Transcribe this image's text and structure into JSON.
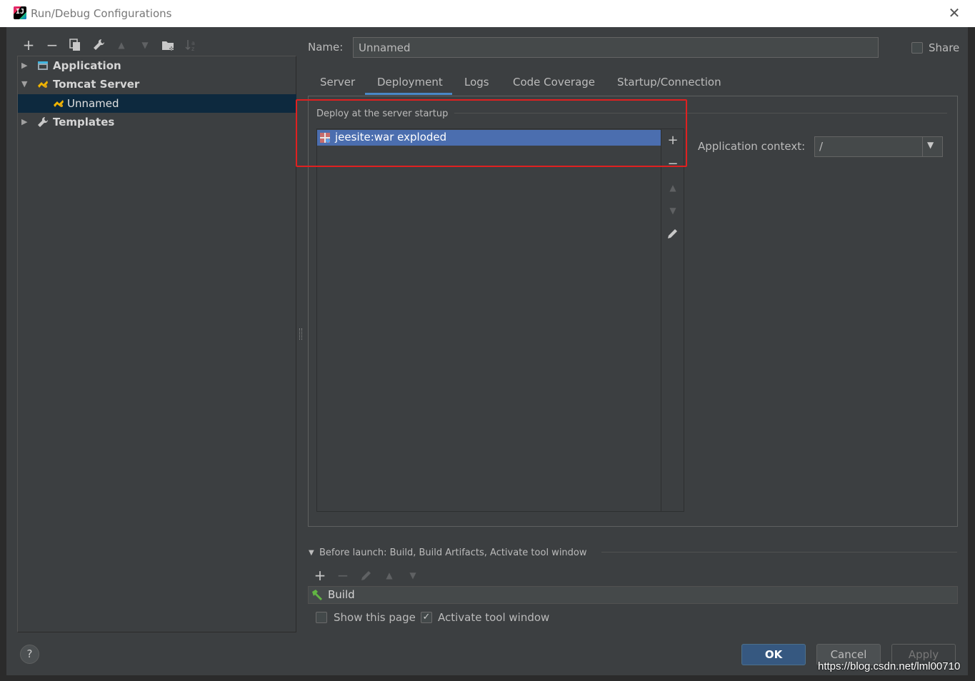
{
  "window": {
    "title": "Run/Debug Configurations"
  },
  "tree": {
    "items": [
      {
        "label": "Application"
      },
      {
        "label": "Tomcat Server"
      },
      {
        "label": "Unnamed"
      },
      {
        "label": "Templates"
      }
    ]
  },
  "form": {
    "name_label": "Name:",
    "name_value": "Unnamed",
    "share_label": "Share"
  },
  "tabs": [
    {
      "label": "Server"
    },
    {
      "label": "Deployment"
    },
    {
      "label": "Logs"
    },
    {
      "label": "Code Coverage"
    },
    {
      "label": "Startup/Connection"
    }
  ],
  "active_tab": "Deployment",
  "deployment": {
    "legend": "Deploy at the server startup",
    "artifacts": [
      {
        "label": "jeesite:war exploded"
      }
    ],
    "context_label": "Application context:",
    "context_value": "/"
  },
  "before_launch": {
    "label": "Before launch: Build, Build Artifacts, Activate tool window",
    "tasks": [
      {
        "label": "Build"
      }
    ],
    "show_page_label": "Show this page",
    "show_page_checked": false,
    "activate_label": "Activate tool window",
    "activate_checked": true
  },
  "buttons": {
    "help": "?",
    "ok": "OK",
    "cancel": "Cancel",
    "apply": "Apply"
  },
  "watermark": "https://blog.csdn.net/lml00710",
  "colors": {
    "background": "#3c3f41",
    "selection": "#4b6eaf",
    "tree_selection": "#0d293e",
    "highlight_box": "#e02020",
    "ok_button": "#365880"
  }
}
